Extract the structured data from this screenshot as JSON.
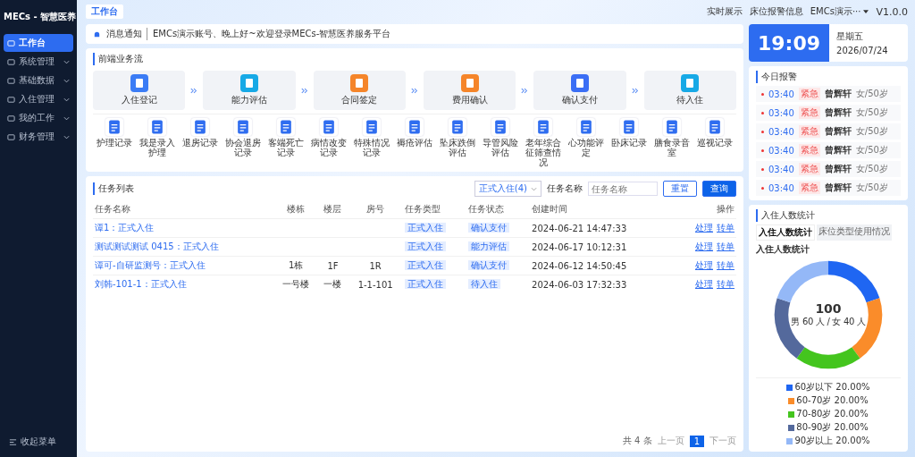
{
  "sidebar": {
    "title": "MECs - 智慧医养",
    "items": [
      {
        "label": "工作台",
        "selected": true,
        "expandable": false
      },
      {
        "label": "系统管理",
        "selected": false,
        "expandable": true
      },
      {
        "label": "基础数据",
        "selected": false,
        "expandable": true
      },
      {
        "label": "入住管理",
        "selected": false,
        "expandable": true
      },
      {
        "label": "我的工作",
        "selected": false,
        "expandable": true
      },
      {
        "label": "财务管理",
        "selected": false,
        "expandable": true
      }
    ],
    "collapse": "收起菜单"
  },
  "top_bar": {
    "tabs": [
      {
        "label": "工作台",
        "selected": true
      }
    ],
    "links": [
      "实时展示",
      "床位报警信息"
    ],
    "user": "EMCs演示···",
    "version": "V1.0.0"
  },
  "notice": {
    "label": "消息通知",
    "text": "EMCs演示账号、晚上好~欢迎登录MECs-智慧医养服务平台"
  },
  "flow": {
    "title": "前端业务流",
    "steps": [
      {
        "label": "入住登记",
        "color": "#3b7cf5"
      },
      {
        "label": "能力评估",
        "color": "#17a9e6"
      },
      {
        "label": "合同签定",
        "color": "#f5852a"
      },
      {
        "label": "费用确认",
        "color": "#f5852a"
      },
      {
        "label": "确认支付",
        "color": "#3b6ef5"
      },
      {
        "label": "待入住",
        "color": "#17a9e6"
      }
    ],
    "records": [
      "护理记录",
      "我是录入护理",
      "退房记录",
      "协会退房记录",
      "客端死亡记录",
      "病情改变记录",
      "特殊情况记录",
      "褥疮评估",
      "坠床跌倒评估",
      "导管风险评估",
      "老年综合征筛查情况",
      "心功能评定",
      "卧床记录",
      "膳食录音室",
      "巡视记录"
    ]
  },
  "tasks": {
    "title": "任务列表",
    "filter": "正式入住(4)",
    "search_label": "任务名称",
    "search_placeholder": "任务名称",
    "reset": "重置",
    "query": "查询",
    "columns": [
      "任务名称",
      "楼栋",
      "楼层",
      "房号",
      "任务类型",
      "任务状态",
      "创建时间",
      "操作"
    ],
    "rows": [
      {
        "name": "谭1：正式入住",
        "building": "",
        "floor": "",
        "room": "",
        "type": "正式入住",
        "status": "确认支付",
        "created": "2024-06-21 14:47:33",
        "actions": [
          "处理",
          "转单"
        ]
      },
      {
        "name": "测试测试测试 0415：正式入住",
        "building": "",
        "floor": "",
        "room": "",
        "type": "正式入住",
        "status": "能力评估",
        "created": "2024-06-17 10:12:31",
        "actions": [
          "处理",
          "转单"
        ]
      },
      {
        "name": "谭可-自研监测号：正式入住",
        "building": "1栋",
        "floor": "1F",
        "room": "1R",
        "type": "正式入住",
        "status": "确认支付",
        "created": "2024-06-12 14:50:45",
        "actions": [
          "处理",
          "转单"
        ]
      },
      {
        "name": "刘韩-101-1：正式入住",
        "building": "一号楼",
        "floor": "一楼",
        "room": "1-1-101",
        "type": "正式入住",
        "status": "待入住",
        "created": "2024-06-03 17:32:33",
        "actions": [
          "处理",
          "转单"
        ]
      }
    ],
    "pagination": {
      "total": "共 4 条",
      "prev": "上一页",
      "pages": [
        {
          "label": "1",
          "selected": true
        }
      ],
      "next": "下一页"
    }
  },
  "clock": {
    "time": "19:09",
    "weekday": "星期五",
    "date": "2026/07/24"
  },
  "alarms": {
    "title": "今日报警",
    "items": [
      {
        "time": "03:40",
        "tag": "紧急",
        "name": "曾辉轩",
        "info": "女/50岁"
      },
      {
        "time": "03:40",
        "tag": "紧急",
        "name": "曾辉轩",
        "info": "女/50岁"
      },
      {
        "time": "03:40",
        "tag": "紧急",
        "name": "曾辉轩",
        "info": "女/50岁"
      },
      {
        "time": "03:40",
        "tag": "紧急",
        "name": "曾辉轩",
        "info": "女/50岁"
      },
      {
        "time": "03:40",
        "tag": "紧急",
        "name": "曾辉轩",
        "info": "女/50岁"
      },
      {
        "time": "03:40",
        "tag": "紧急",
        "name": "曾辉轩",
        "info": "女/50岁"
      }
    ]
  },
  "stats": {
    "title": "入住人数统计",
    "tabs": [
      {
        "label": "入住人数统计",
        "selected": true
      },
      {
        "label": "床位类型使用情况",
        "selected": false
      }
    ],
    "heading": "入住人数统计",
    "total": "100",
    "subtitle": "男 60 人 / 女 40 人",
    "chart_data": {
      "type": "donut",
      "categories": [
        "60岁以下",
        "60-70岁",
        "70-80岁",
        "80-90岁",
        "90岁以上"
      ],
      "series": [
        {
          "values": [
            20,
            20,
            20,
            20,
            20
          ]
        }
      ],
      "colors": [
        "#1f66f2",
        "#fa8c2a",
        "#44c51e",
        "#54699c",
        "#94b8f7"
      ],
      "value_labels": [
        "20.00%",
        "20.00%",
        "20.00%",
        "20.00%",
        "20.00%"
      ]
    }
  }
}
